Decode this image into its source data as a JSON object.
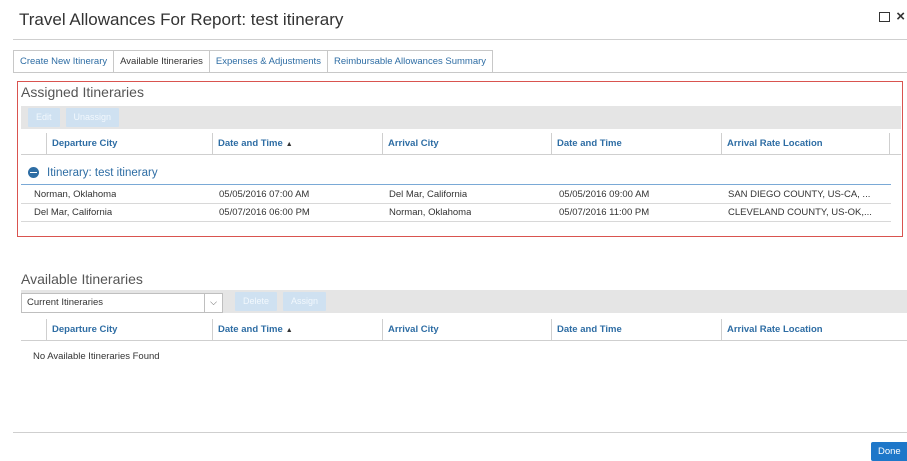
{
  "dialog": {
    "title": "Travel Allowances For Report: test itinerary"
  },
  "tabs": [
    {
      "label": "Create New Itinerary"
    },
    {
      "label": "Available Itineraries"
    },
    {
      "label": "Expenses & Adjustments"
    },
    {
      "label": "Reimbursable Allowances Summary"
    }
  ],
  "assigned": {
    "title": "Assigned Itineraries",
    "edit_label": "Edit",
    "unassign_label": "Unassign",
    "columns": [
      "Departure City",
      "Date and Time",
      "Arrival City",
      "Date and Time",
      "Arrival Rate Location"
    ],
    "sort_indicator": "▲",
    "group_label": "Itinerary: test itinerary",
    "rows": [
      [
        "Norman, Oklahoma",
        "05/05/2016 07:00 AM",
        "Del Mar, California",
        "05/05/2016 09:00 AM",
        "SAN DIEGO COUNTY, US-CA, ..."
      ],
      [
        "Del Mar, California",
        "05/07/2016 06:00 PM",
        "Norman, Oklahoma",
        "05/07/2016 11:00 PM",
        "CLEVELAND COUNTY, US-OK,..."
      ]
    ]
  },
  "available": {
    "title": "Available Itineraries",
    "filter_value": "Current Itineraries",
    "delete_label": "Delete",
    "assign_label": "Assign",
    "columns": [
      "Departure City",
      "Date and Time",
      "Arrival City",
      "Date and Time",
      "Arrival Rate Location"
    ],
    "sort_indicator": "▲",
    "empty_message": "No Available Itineraries Found"
  },
  "footer": {
    "done_label": "Done"
  },
  "colors": {
    "accent": "#2e6da4",
    "highlight_border": "#d9534f",
    "done_button": "#1e77c9"
  },
  "icons": {
    "maximize": "maximize-icon",
    "close": "close-icon",
    "collapse": "minus-circle-icon",
    "dropdown": "chevron-down-icon",
    "sort": "sort-ascending-icon"
  }
}
